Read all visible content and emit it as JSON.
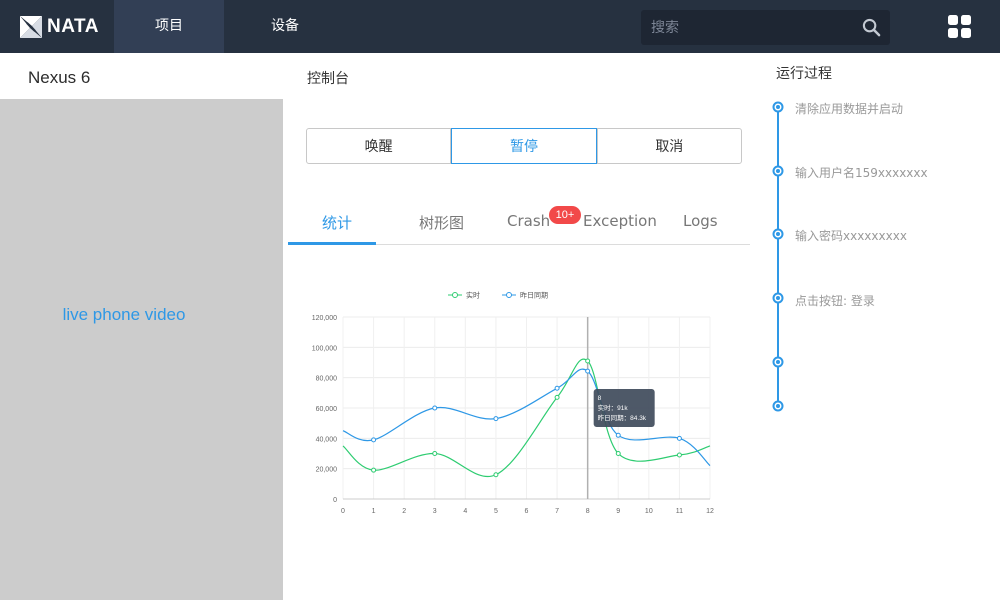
{
  "nav": {
    "logo_text": "NATA",
    "items": [
      {
        "label": "项目",
        "active": true
      },
      {
        "label": "设备",
        "active": false
      }
    ],
    "search_placeholder": "搜索",
    "search_icon": "search-icon",
    "apps_icon": "grid-apps-icon"
  },
  "device": {
    "name": "Nexus 6",
    "video_label": "live phone video"
  },
  "console": {
    "title": "控制台",
    "buttons": [
      {
        "label": "唤醒",
        "active": false
      },
      {
        "label": "暂停",
        "active": true
      },
      {
        "label": "取消",
        "active": false
      }
    ],
    "tabs": [
      {
        "label": "统计",
        "active": true
      },
      {
        "label": "树形图",
        "active": false
      },
      {
        "label": "Crash",
        "active": false
      },
      {
        "label": "Exception",
        "active": false
      },
      {
        "label": "Logs",
        "active": false
      }
    ],
    "crash_badge": "10+"
  },
  "timeline": {
    "title": "运行过程",
    "steps": [
      {
        "label": "清除应用数据并启动"
      },
      {
        "label": "输入用户名159xxxxxxx"
      },
      {
        "label": "输入密码xxxxxxxxx"
      },
      {
        "label": "点击按钮: 登录"
      },
      {
        "label": ""
      },
      {
        "label": ""
      }
    ]
  },
  "colors": {
    "nav_bg": "#263140",
    "nav_active": "#323f55",
    "accent": "#2e98e6",
    "realtime": "#2ecc71",
    "yesterday": "#2e98e6",
    "badge": "#f24949"
  },
  "chart_data": {
    "type": "line",
    "x": [
      0,
      1,
      2,
      3,
      4,
      5,
      6,
      7,
      8,
      9,
      10,
      11,
      12
    ],
    "xticks": [
      "0",
      "1",
      "2",
      "3",
      "4",
      "5",
      "6",
      "7",
      "8",
      "9",
      "10",
      "11",
      "12"
    ],
    "yticks": [
      "0",
      "20,000",
      "40,000",
      "60,000",
      "80,000",
      "100,000",
      "120,000"
    ],
    "ylim": [
      0,
      120000
    ],
    "xlim": [
      0,
      12
    ],
    "grid": true,
    "legend": "top-center",
    "series": [
      {
        "name": "实时",
        "color": "#2ecc71",
        "points": [
          [
            0,
            35000
          ],
          [
            1,
            19000
          ],
          [
            3,
            30000
          ],
          [
            5,
            16000
          ],
          [
            7,
            67000
          ],
          [
            8,
            91000
          ],
          [
            9,
            30000
          ],
          [
            11,
            29000
          ],
          [
            12,
            35000
          ]
        ],
        "marker_x": [
          1,
          3,
          5,
          7,
          8,
          9,
          11
        ]
      },
      {
        "name": "昨日同期",
        "color": "#2e98e6",
        "points": [
          [
            0,
            45000
          ],
          [
            1,
            39000
          ],
          [
            3,
            60000
          ],
          [
            5,
            53000
          ],
          [
            7,
            73000
          ],
          [
            8,
            84300
          ],
          [
            9,
            42000
          ],
          [
            11,
            40000
          ],
          [
            12,
            22000
          ]
        ],
        "marker_x": [
          1,
          3,
          5,
          7,
          8,
          9,
          11
        ]
      }
    ],
    "tooltip": {
      "x": 8,
      "title": "8",
      "lines": [
        "实时：91k",
        "昨日同期：84.3k"
      ]
    }
  }
}
